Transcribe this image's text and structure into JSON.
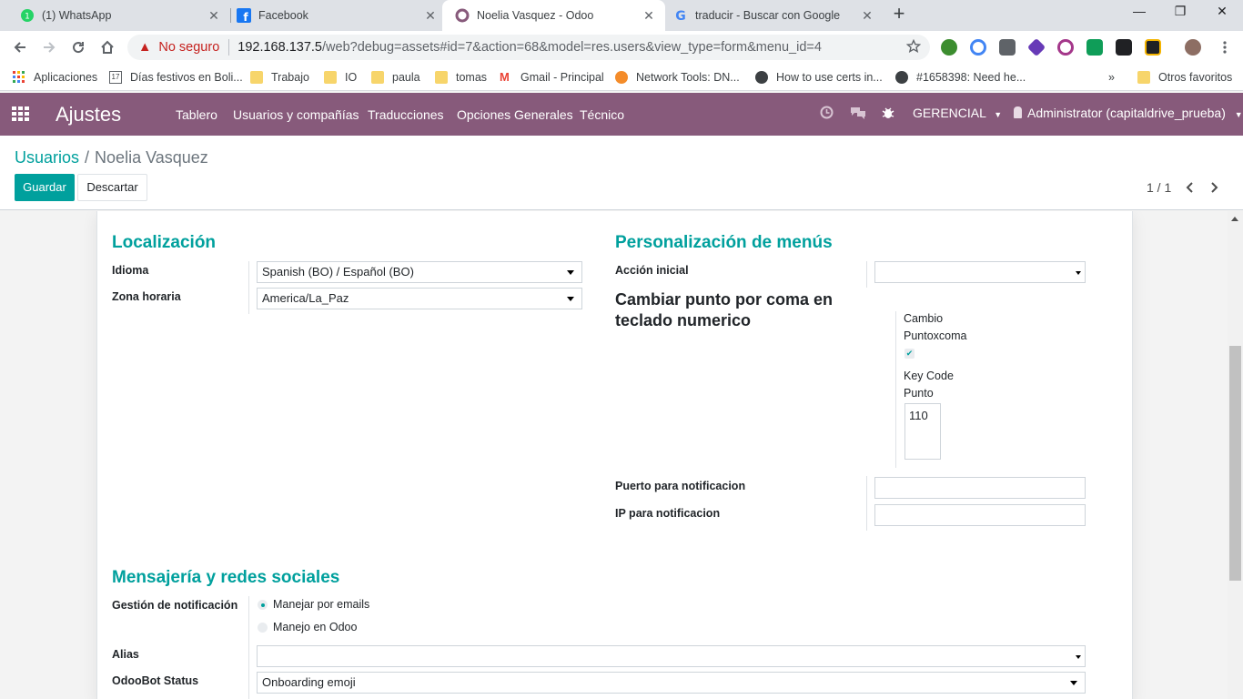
{
  "browser": {
    "tabs": [
      {
        "title": "(1) WhatsApp",
        "icon": "whatsapp-icon",
        "active": false
      },
      {
        "title": "Facebook",
        "icon": "facebook-icon",
        "active": false
      },
      {
        "title": "Noelia Vasquez - Odoo",
        "icon": "odoo-icon",
        "active": true
      },
      {
        "title": "traducir - Buscar con Google",
        "icon": "google-icon",
        "active": false
      }
    ],
    "address": {
      "security": "No seguro",
      "host": "192.168.137.5",
      "path": "/web?debug=assets#id=7&action=68&model=res.users&view_type=form&menu_id=4"
    },
    "bookmarks": [
      {
        "label": "Aplicaciones",
        "icon": "apps-grid-icon"
      },
      {
        "label": "Días festivos en Boli...",
        "icon": "calendar-icon"
      },
      {
        "label": "Trabajo",
        "icon": "folder-icon"
      },
      {
        "label": "IO",
        "icon": "folder-icon"
      },
      {
        "label": "paula",
        "icon": "folder-icon"
      },
      {
        "label": "tomas",
        "icon": "folder-icon"
      },
      {
        "label": "Gmail - Principal",
        "icon": "gmail-icon"
      },
      {
        "label": "Network Tools: DN...",
        "icon": "network-tools-icon"
      },
      {
        "label": "How to use certs in...",
        "icon": "github-icon"
      },
      {
        "label": "#1658398: Need he...",
        "icon": "github-icon"
      }
    ],
    "other_bookmarks": "Otros favoritos",
    "overflow": "»"
  },
  "odoo": {
    "app_name": "Ajustes",
    "menu": [
      "Tablero",
      "Usuarios y compañías",
      "Traducciones",
      "Opciones Generales",
      "Técnico"
    ],
    "company": "GERENCIAL",
    "user": "Administrator (capitaldrive_prueba)",
    "accent": "#00a09d",
    "navbar_color": "#875a7b"
  },
  "control_panel": {
    "breadcrumb_parent": "Usuarios",
    "breadcrumb_sep": "/",
    "breadcrumb_current": "Noelia Vasquez",
    "save": "Guardar",
    "discard": "Descartar",
    "pager": "1 / 1"
  },
  "form": {
    "localizacion": {
      "title": "Localización",
      "idioma_label": "Idioma",
      "idioma_value": "Spanish (BO) / Español (BO)",
      "tz_label": "Zona horaria",
      "tz_value": "America/La_Paz"
    },
    "menus": {
      "title": "Personalización de menús",
      "accion_label": "Acción inicial",
      "accion_value": ""
    },
    "teclado": {
      "title_line1": "Cambiar punto por coma en",
      "title_line2": "teclado numerico",
      "cambio_label_1": "Cambio",
      "cambio_label_2": "Puntoxcoma",
      "cambio_checked": true,
      "keycode_label_1": "Key Code",
      "keycode_label_2": "Punto",
      "keycode_value": "110"
    },
    "notif": {
      "puerto_label": "Puerto para notificacion",
      "ip_label": "IP para notificacion"
    },
    "mensajeria": {
      "title": "Mensajería y redes sociales",
      "gestion_label": "Gestión de notificación",
      "option_emails": "Manejar por emails",
      "option_odoo": "Manejo en Odoo",
      "selected": "Manejar por emails",
      "alias_label": "Alias",
      "alias_value": "",
      "odoobot_label": "OdooBot Status",
      "odoobot_value": "Onboarding emoji"
    }
  }
}
